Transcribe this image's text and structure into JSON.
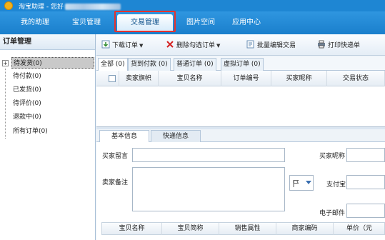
{
  "window": {
    "title": "淘宝助理 - 您好",
    "icon": "taobao-logo-icon"
  },
  "nav": {
    "tabs": [
      {
        "label": "我的助理"
      },
      {
        "label": "宝贝管理"
      },
      {
        "label": "交易管理",
        "active": true
      },
      {
        "label": "图片空间"
      },
      {
        "label": "应用中心"
      }
    ],
    "highlight_color": "#e5322d"
  },
  "sidebar": {
    "title": "订单管理",
    "items": [
      {
        "label": "待发货(0)",
        "selected": true
      },
      {
        "label": "待付款(0)"
      },
      {
        "label": "已发货(0)"
      },
      {
        "label": "待评价(0)"
      },
      {
        "label": "退款中(0)"
      },
      {
        "label": "所有订单(0)"
      }
    ]
  },
  "toolbar": {
    "download": {
      "label": "下载订单",
      "icon": "download-icon"
    },
    "delete": {
      "label": "删除勾选订单",
      "icon": "red-x-icon"
    },
    "batch_edit": {
      "label": "批量编辑交易",
      "icon": "edit-icon"
    },
    "print": {
      "label": "打印快递单",
      "icon": "printer-icon"
    }
  },
  "order_tabs": [
    "全部 (0)",
    "货到付款 (0)",
    "普通订单 (0)",
    "虚拟订单 (0)"
  ],
  "grid": {
    "columns": [
      "",
      "卖家旗帜",
      "宝贝名称",
      "订单编号",
      "买家昵称",
      "交易状态"
    ]
  },
  "detail": {
    "tabs": [
      "基本信息",
      "快递信息"
    ],
    "buyer_message_label": "买家留言",
    "seller_note_label": "卖家备注",
    "buyer_nick_label": "买家昵称",
    "alipay_label": "支付宝",
    "email_label": "电子邮件"
  },
  "items_table": {
    "columns": [
      "宝贝名称",
      "宝贝简称",
      "销售属性",
      "商家编码",
      "单价（元"
    ]
  }
}
